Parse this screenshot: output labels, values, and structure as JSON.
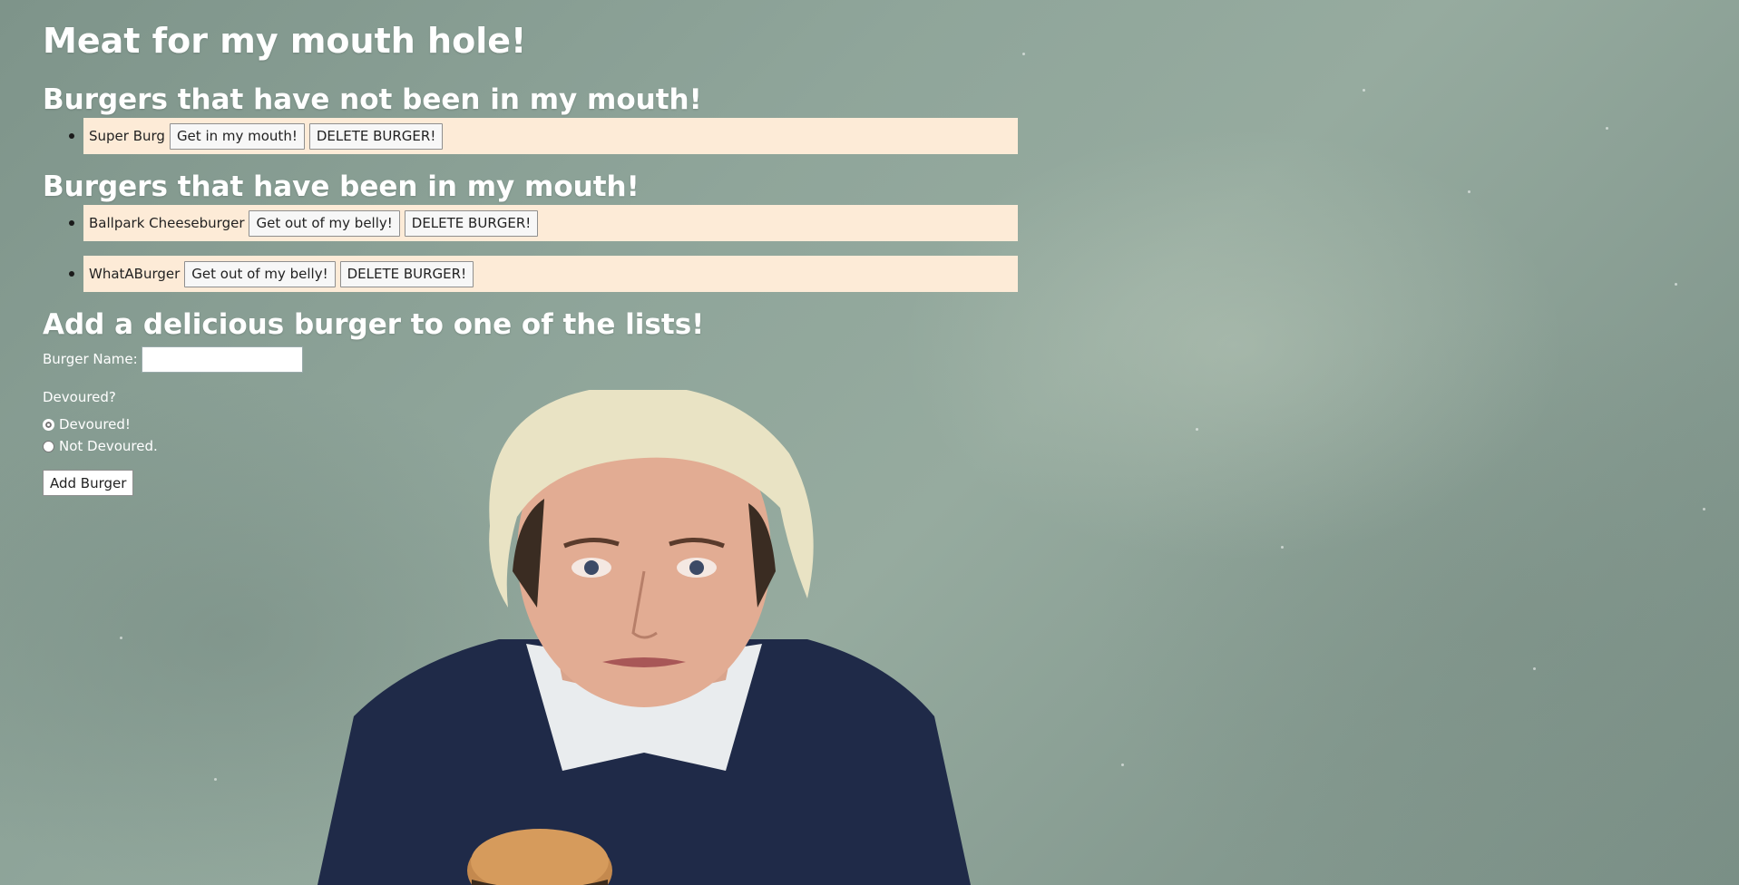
{
  "page": {
    "title": "Meat for my mouth hole!"
  },
  "not_devoured": {
    "heading": "Burgers that have not been in my mouth!",
    "items": [
      {
        "name": "Super Burg",
        "action_label": "Get in my mouth!",
        "delete_label": "DELETE BURGER!"
      }
    ]
  },
  "devoured": {
    "heading": "Burgers that have been in my mouth!",
    "items": [
      {
        "name": "Ballpark Cheeseburger",
        "action_label": "Get out of my belly!",
        "delete_label": "DELETE BURGER!"
      },
      {
        "name": "WhatABurger",
        "action_label": "Get out of my belly!",
        "delete_label": "DELETE BURGER!"
      }
    ]
  },
  "add_form": {
    "heading": "Add a delicious burger to one of the lists!",
    "name_label": "Burger Name:",
    "name_value": "",
    "devoured_question": "Devoured?",
    "options": [
      {
        "label": "Devoured!",
        "checked": true
      },
      {
        "label": "Not Devoured.",
        "checked": false
      }
    ],
    "submit_label": "Add Burger"
  },
  "colors": {
    "item_background": "#fdebd7",
    "heading_text": "#ffffff",
    "page_background": "#8a9f95"
  },
  "background_image": "portrait photo of a man with platinum hair holding a burger"
}
